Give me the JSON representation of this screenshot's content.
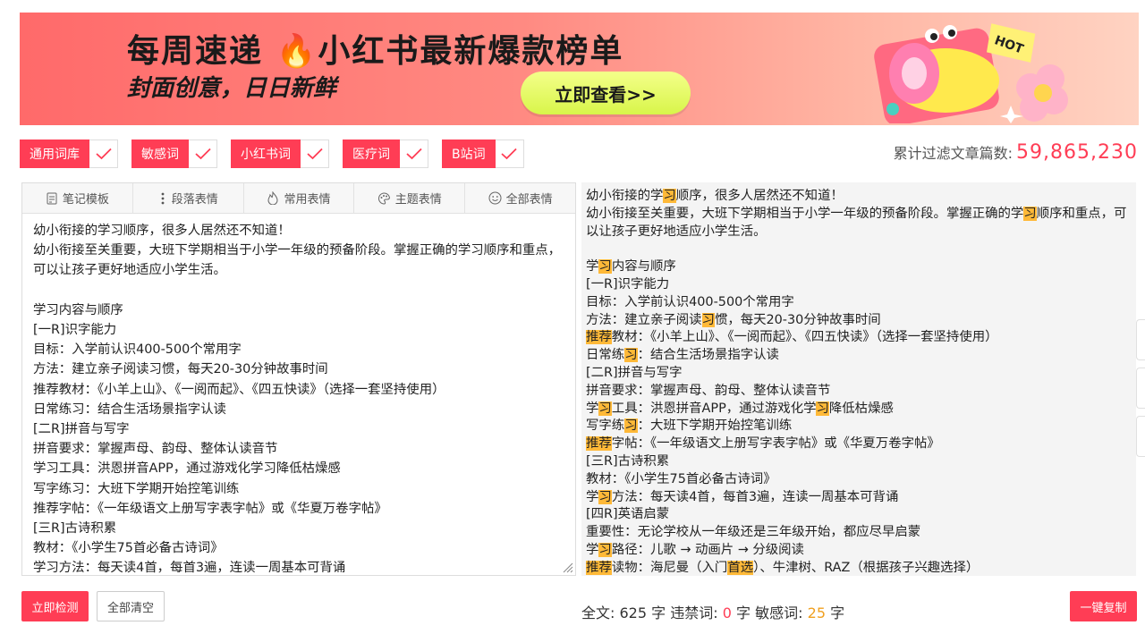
{
  "banner": {
    "title": "每周速递 🔥小红书最新爆款榜单",
    "subtitle": "封面创意，日日新鲜",
    "button": "立即查看>>",
    "hot_badge": "HOT"
  },
  "filters": [
    {
      "label": "通用词库",
      "checked": true
    },
    {
      "label": "敏感词",
      "checked": true
    },
    {
      "label": "小红书词",
      "checked": true
    },
    {
      "label": "医疗词",
      "checked": true
    },
    {
      "label": "B站词",
      "checked": true
    }
  ],
  "counter": {
    "label": "累计过滤文章篇数:",
    "value": "59,865,230"
  },
  "toolbar": [
    {
      "label": "笔记模板",
      "icon": "note-template-icon"
    },
    {
      "label": "段落表情",
      "icon": "vertical-dots-icon"
    },
    {
      "label": "常用表情",
      "icon": "fire-icon"
    },
    {
      "label": "主题表情",
      "icon": "palette-icon"
    },
    {
      "label": "全部表情",
      "icon": "smiley-icon"
    }
  ],
  "editor_text": "幼小衔接的学习顺序，很多人居然还不知道！\n幼小衔接至关重要，大班下学期相当于小学一年级的预备阶段。掌握正确的学习顺序和重点，可以让孩子更好地适应小学生活。\n\n学习内容与顺序\n[一R]识字能力\n目标：入学前认识400-500个常用字\n方法：建立亲子阅读习惯，每天20-30分钟故事时间\n推荐教材：《小羊上山》、《一阅而起》、《四五快读》（选择一套坚持使用）\n日常练习：结合生活场景指字认读\n[二R]拼音与写字\n拼音要求：掌握声母、韵母、整体认读音节\n学习工具：洪恩拼音APP，通过游戏化学习降低枯燥感\n写字练习：大班下学期开始控笔训练\n推荐字帖：《一年级语文上册写字表字帖》或《华夏万卷字帖》\n[三R]古诗积累\n教材：《小学生75首必备古诗词》\n学习方法：每天读4首，每首3遍，连读一周基本可背诵\n[四R]英语启蒙",
  "preview_lines": [
    [
      {
        "t": "幼小衔接的学"
      },
      {
        "t": "习",
        "h": true
      },
      {
        "t": "顺序，很多人居然还不知道！"
      }
    ],
    [
      {
        "t": "幼小衔接至关重要，大班下学期相当于小学一年级的预备阶段。掌握正确的学"
      },
      {
        "t": "习",
        "h": true
      },
      {
        "t": "顺序和重点，可以让孩子更好地适应小学生活。"
      }
    ],
    [
      {
        "t": ""
      }
    ],
    [
      {
        "t": "学"
      },
      {
        "t": "习",
        "h": true
      },
      {
        "t": "内容与顺序"
      }
    ],
    [
      {
        "t": "[一R]识字能力"
      }
    ],
    [
      {
        "t": "目标：入学前认识400-500个常用字"
      }
    ],
    [
      {
        "t": "方法：建立亲子阅读"
      },
      {
        "t": "习",
        "h": true
      },
      {
        "t": "惯，每天20-30分钟故事时间"
      }
    ],
    [
      {
        "t": "推荐",
        "h": true
      },
      {
        "t": "教材：《小羊上山》、《一阅而起》、《四五快读》（选择一套坚持使用）"
      }
    ],
    [
      {
        "t": "日常练"
      },
      {
        "t": "习",
        "h": true
      },
      {
        "t": "：结合生活场景指字认读"
      }
    ],
    [
      {
        "t": "[二R]拼音与写字"
      }
    ],
    [
      {
        "t": "拼音要求：掌握声母、韵母、整体认读音节"
      }
    ],
    [
      {
        "t": "学"
      },
      {
        "t": "习",
        "h": true
      },
      {
        "t": "工具：洪恩拼音APP，通过游戏化学"
      },
      {
        "t": "习",
        "h": true
      },
      {
        "t": "降低枯燥感"
      }
    ],
    [
      {
        "t": "写字练"
      },
      {
        "t": "习",
        "h": true
      },
      {
        "t": "：大班下学期开始控笔训练"
      }
    ],
    [
      {
        "t": "推荐",
        "h": true
      },
      {
        "t": "字帖：《一年级语文上册写字表字帖》或《华夏万卷字帖》"
      }
    ],
    [
      {
        "t": "[三R]古诗积累"
      }
    ],
    [
      {
        "t": "教材：《小学生75首必备古诗词》"
      }
    ],
    [
      {
        "t": "学"
      },
      {
        "t": "习",
        "h": true
      },
      {
        "t": "方法：每天读4首，每首3遍，连读一周基本可背诵"
      }
    ],
    [
      {
        "t": "[四R]英语启蒙"
      }
    ],
    [
      {
        "t": "重要性：无论学校从一年级还是三年级开始，都应尽早启蒙"
      }
    ],
    [
      {
        "t": "学"
      },
      {
        "t": "习",
        "h": true
      },
      {
        "t": "路径：儿歌 → 动画片 → 分级阅读"
      }
    ],
    [
      {
        "t": "推荐",
        "h": true
      },
      {
        "t": "读物：海尼曼（入门"
      },
      {
        "t": "首选",
        "h": true
      },
      {
        "t": "）、牛津树、RAZ（根据孩子兴趣选择）"
      }
    ]
  ],
  "buttons": {
    "detect": "立即检测",
    "clear": "全部清空",
    "copy": "一键复制"
  },
  "stats": {
    "total_label": "全文:",
    "total_value": "625",
    "unit": "字",
    "banned_label": "违禁词:",
    "banned_value": "0",
    "sensitive_label": "敏感词:",
    "sensitive_value": "25"
  },
  "colors": {
    "accent": "#ff3d55",
    "highlight": "#ffb938",
    "sensitive": "#f0a020"
  }
}
